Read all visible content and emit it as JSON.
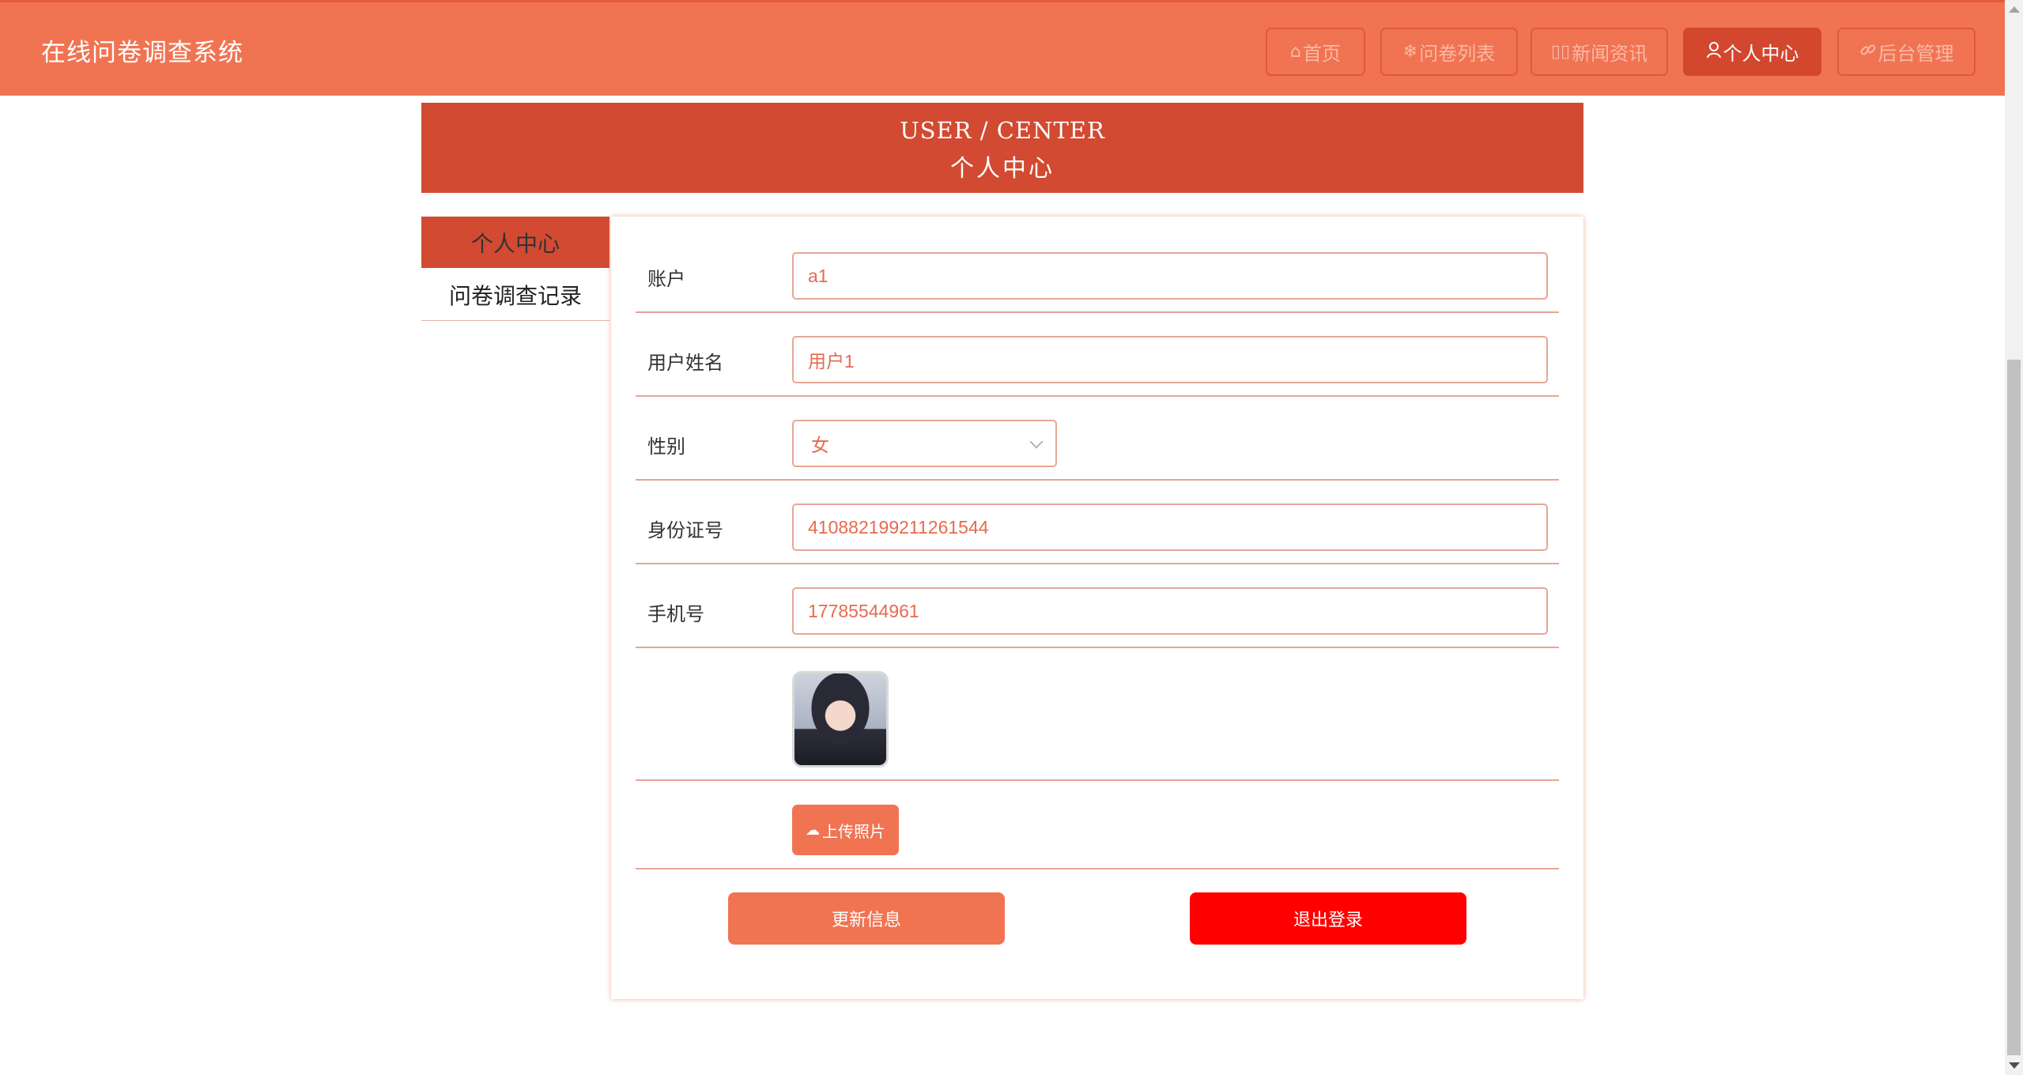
{
  "header": {
    "title": "在线问卷调查系统",
    "nav": [
      {
        "icon": "home-icon",
        "glyph": "⌂",
        "label": "首页"
      },
      {
        "icon": "snowflake-icon",
        "glyph": "❄",
        "label": "问卷列表"
      },
      {
        "icon": "news-icon",
        "glyph": "▯▯",
        "label": "新闻资讯"
      },
      {
        "icon": "user-icon",
        "glyph": "♀",
        "label": "个人中心"
      },
      {
        "icon": "link-icon",
        "glyph": "🔗",
        "label": "后台管理"
      }
    ],
    "active_nav": "个人中心"
  },
  "banner": {
    "en": "USER / CENTER",
    "cn": "个人中心"
  },
  "menu": {
    "items": [
      "个人中心",
      "问卷调查记录"
    ],
    "active": "个人中心"
  },
  "form": {
    "account": {
      "label": "账户",
      "value": "a1"
    },
    "name": {
      "label": "用户姓名",
      "value": "用户1"
    },
    "gender": {
      "label": "性别",
      "value": "女"
    },
    "id_number": {
      "label": "身份证号",
      "value": "410882199211261544"
    },
    "phone": {
      "label": "手机号",
      "value": "17785544961"
    },
    "upload_label": "上传照片",
    "update_label": "更新信息",
    "logout_label": "退出登录"
  },
  "colors": {
    "primary": "#f07452",
    "dark": "#d24a31",
    "danger": "#ff0000"
  }
}
